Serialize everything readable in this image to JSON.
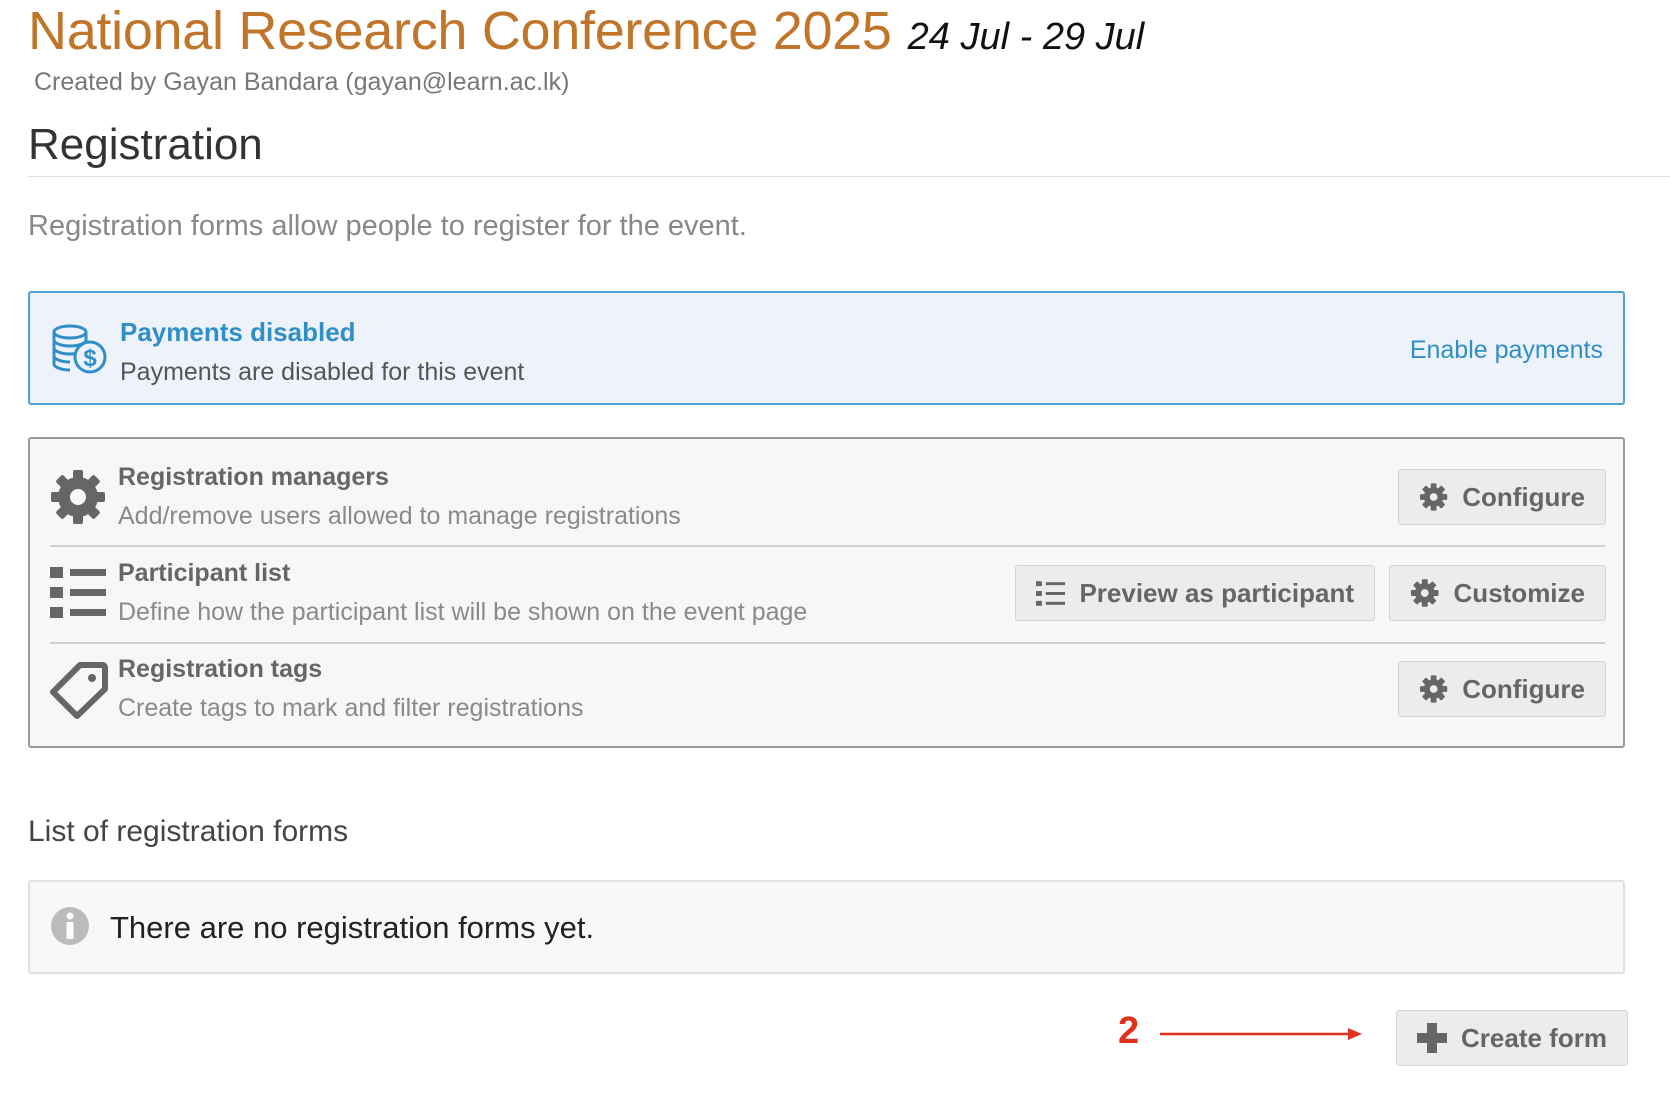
{
  "event": {
    "title": "National Research Conference 2025",
    "dates": "24 Jul - 29 Jul",
    "created_by": "Created by Gayan Bandara (gayan@learn.ac.lk)"
  },
  "section": {
    "title": "Registration",
    "description": "Registration forms allow people to register for the event."
  },
  "payments": {
    "icon": "coins-dollar-icon",
    "title": "Payments disabled",
    "subtitle": "Payments are disabled for this event",
    "action": "Enable payments"
  },
  "settings": {
    "managers": {
      "icon": "gear-icon",
      "title": "Registration managers",
      "subtitle": "Add/remove users allowed to manage registrations",
      "button": "Configure"
    },
    "participant_list": {
      "icon": "list-icon",
      "title": "Participant list",
      "subtitle": "Define how the participant list will be shown on the event page",
      "preview_button": "Preview as participant",
      "customize_button": "Customize"
    },
    "tags": {
      "icon": "tag-icon",
      "title": "Registration tags",
      "subtitle": "Create tags to mark and filter registrations",
      "button": "Configure"
    }
  },
  "forms": {
    "heading": "List of registration forms",
    "empty_message": "There are no registration forms yet.",
    "create_button": "Create form"
  },
  "annotation": {
    "number": "2"
  },
  "colors": {
    "title": "#c0752b",
    "link": "#2f8fc6",
    "info_border": "#4fa3d1",
    "info_bg": "#edf2fb",
    "annotation": "#e0301e"
  }
}
